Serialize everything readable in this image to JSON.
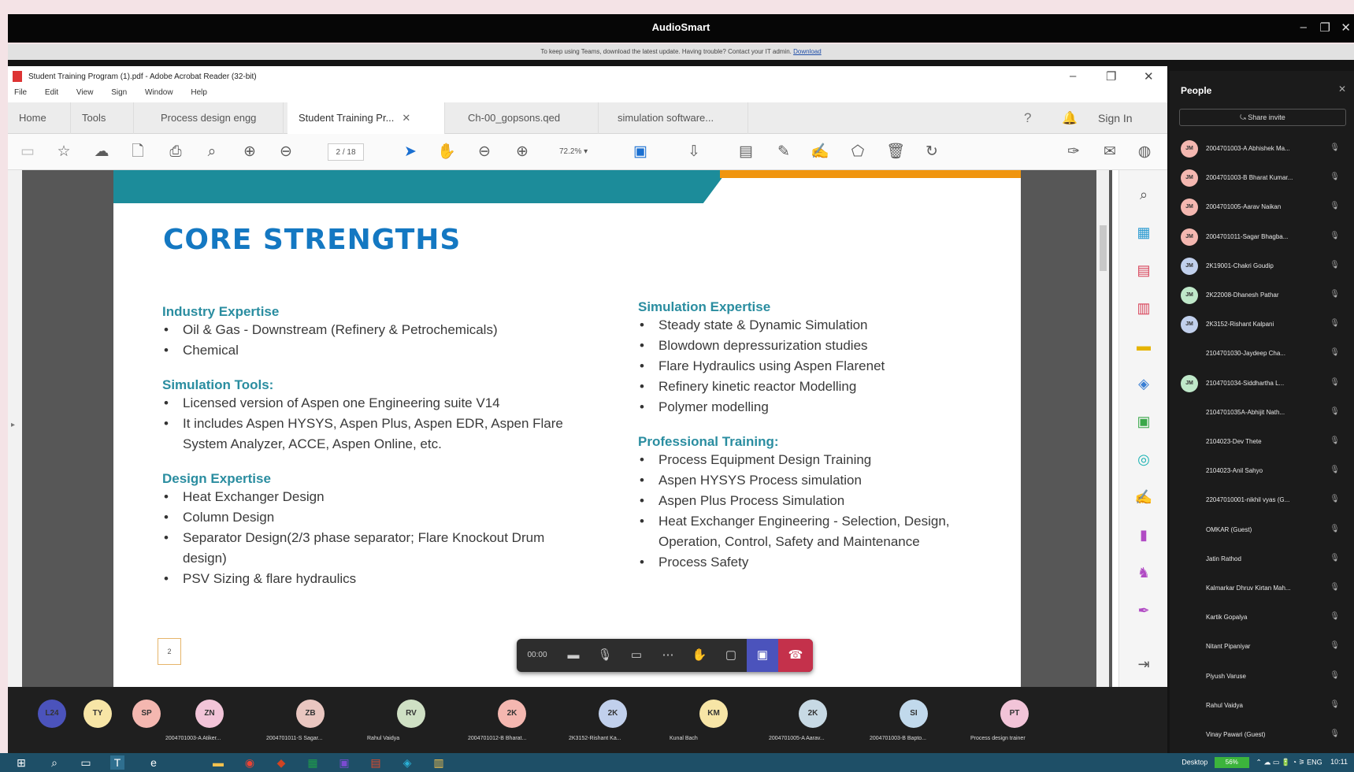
{
  "teams": {
    "title": "AudioSmart",
    "notice_text": "To keep using Teams, download the latest update. Having trouble? Contact your IT admin.",
    "notice_link": "Download"
  },
  "acrobat": {
    "title": "Student Training Program (1).pdf - Adobe Acrobat Reader (32-bit)",
    "menu": [
      "File",
      "Edit",
      "View",
      "Sign",
      "Window",
      "Help"
    ],
    "tabs": [
      "Home",
      "Tools",
      "Process design engg",
      "Student Training Pr...",
      "Ch-00_gopsons.qed",
      "simulation software..."
    ],
    "sign_in": "Sign In",
    "page_indicator": "2 / 18",
    "zoom": "72.2%"
  },
  "document": {
    "heading": "CORE STRENGTHS",
    "sections_left": [
      {
        "title": "Industry Expertise",
        "items": [
          "Oil & Gas - Downstream (Refinery & Petrochemicals)",
          "Chemical"
        ]
      },
      {
        "title": "Simulation Tools:",
        "items": [
          "Licensed version of Aspen one Engineering suite V14",
          "It includes Aspen HYSYS, Aspen Plus, Aspen EDR, Aspen Flare System Analyzer, ACCE, Aspen Online, etc."
        ]
      },
      {
        "title": "Design Expertise",
        "items": [
          "Heat Exchanger Design",
          "Column Design",
          "Separator Design(2/3 phase separator; Flare Knockout Drum design)",
          "PSV Sizing & flare hydraulics"
        ]
      }
    ],
    "sections_right": [
      {
        "title": "Simulation Expertise",
        "items": [
          "Steady state & Dynamic Simulation",
          "Blowdown depressurization studies",
          "Flare Hydraulics using Aspen Flarenet",
          "Refinery kinetic reactor Modelling",
          "Polymer modelling"
        ]
      },
      {
        "title": "Professional Training:",
        "items": [
          "Process Equipment Design Training",
          "Aspen HYSYS Process simulation",
          "Aspen Plus Process Simulation",
          "Heat Exchanger Engineering - Selection, Design, Operation, Control, Safety and Maintenance",
          "Process Safety"
        ]
      }
    ],
    "page_label": "2"
  },
  "call_controls": {
    "timer": "00:00"
  },
  "people": {
    "title": "People",
    "share_invite": "Share invite",
    "participants": [
      {
        "initials": "JM",
        "name": "2004701003-A Abhishek Ma...",
        "color": "#f4b7b0"
      },
      {
        "initials": "JM",
        "name": "2004701003-B Bharat Kumar...",
        "color": "#f4b7b0"
      },
      {
        "initials": "JM",
        "name": "2004701005-Aarav Naikan",
        "color": "#f4b7b0"
      },
      {
        "initials": "JM",
        "name": "2004701011-Sagar Bhagba...",
        "color": "#f4b7b0"
      },
      {
        "initials": "JM",
        "name": "2K19001-Chakri Goudip",
        "color": "#c1d0ec"
      },
      {
        "initials": "JM",
        "name": "2K22008-Dhanesh Pathar",
        "color": "#bfe8c9"
      },
      {
        "initials": "JM",
        "name": "2K3152-Rishant Kalpani",
        "color": "#c1d0ec"
      },
      {
        "initials": "",
        "name": "2104701030-Jaydeep Cha...",
        "color": ""
      },
      {
        "initials": "JM",
        "name": "2104701034-Siddhartha L...",
        "color": "#bfe8c9"
      },
      {
        "initials": "",
        "name": "2104701035A-Abhijit Nath...",
        "color": ""
      },
      {
        "initials": "",
        "name": "2104023-Dev Thete",
        "color": ""
      },
      {
        "initials": "",
        "name": "2104023-Anil Sahyo",
        "color": ""
      },
      {
        "initials": "",
        "name": "22047010001-nikhil vyas (G...",
        "color": ""
      },
      {
        "initials": "",
        "name": "OMKAR (Guest)",
        "color": ""
      },
      {
        "initials": "",
        "name": "Jatin Rathod",
        "color": ""
      },
      {
        "initials": "",
        "name": "Kalmarkar Dhruv Kirtan Mah...",
        "color": ""
      },
      {
        "initials": "",
        "name": "Kartik Gopalya",
        "color": ""
      },
      {
        "initials": "",
        "name": "Nitant Pipaniyar",
        "color": ""
      },
      {
        "initials": "",
        "name": "Piyush Varuse",
        "color": ""
      },
      {
        "initials": "",
        "name": "Rahul Vaidya",
        "color": ""
      },
      {
        "initials": "",
        "name": "Vinay Pawari (Guest)",
        "color": ""
      }
    ]
  },
  "gallery": [
    {
      "initials": "L24",
      "name": "",
      "color": "#4b53bc"
    },
    {
      "initials": "TY",
      "name": "",
      "color": "#f7e5a6"
    },
    {
      "initials": "SP",
      "name": "",
      "color": "#f4b7b0"
    },
    {
      "initials": "ZN",
      "name": "2004701003-A Atiker...",
      "color": "#f2c4d8"
    },
    {
      "initials": "ZB",
      "name": "2004701011-S Sagar...",
      "color": "#e9c6c0"
    },
    {
      "initials": "RV",
      "name": "Rahul Vaidya",
      "color": "#cfe0c4"
    },
    {
      "initials": "2K",
      "name": "2004701012-B Bharat...",
      "color": "#f4b7b0"
    },
    {
      "initials": "2K",
      "name": "2K3152-Rishant Ka...",
      "color": "#c1d0ec"
    },
    {
      "initials": "KM",
      "name": "Kunal Bach",
      "color": "#f7e5a6"
    },
    {
      "initials": "2K",
      "name": "2004701005-A Aarav...",
      "color": "#c7d9e4"
    },
    {
      "initials": "SI",
      "name": "2004701003-B Bapto...",
      "color": "#c1d9ec"
    },
    {
      "initials": "PT",
      "name": "Process design trainer",
      "color": "#f2c4d8"
    }
  ],
  "taskbar": {
    "desktop_label": "Desktop",
    "battery": "56%",
    "lang": "ENG",
    "time": "10:11"
  }
}
